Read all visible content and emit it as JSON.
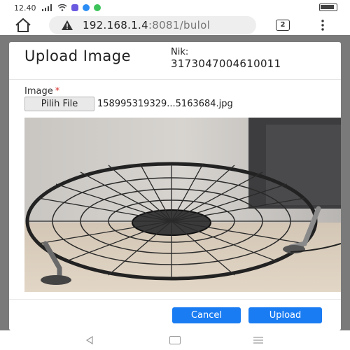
{
  "status_bar": {
    "time": "12.40"
  },
  "browser": {
    "url_host": "192.168.1.4",
    "url_path": ":8081/bulol",
    "tab_count": "2"
  },
  "modal": {
    "title": "Upload Image",
    "nik_label": "Nik:",
    "nik_value": "3173047004610011",
    "image_label": "Image",
    "required_mark": "*",
    "file_button_label": "Pilih File",
    "file_name": "158995319329...5163684.jpg",
    "cancel_label": "Cancel",
    "upload_label": "Upload"
  },
  "colors": {
    "primary_button": "#1a7cf2",
    "required": "#d9302c",
    "backdrop": "#7a7a7a"
  },
  "icons": {
    "home": "home-icon",
    "warning": "warning-icon",
    "tabs": "tabs-icon",
    "menu": "menu-icon"
  }
}
